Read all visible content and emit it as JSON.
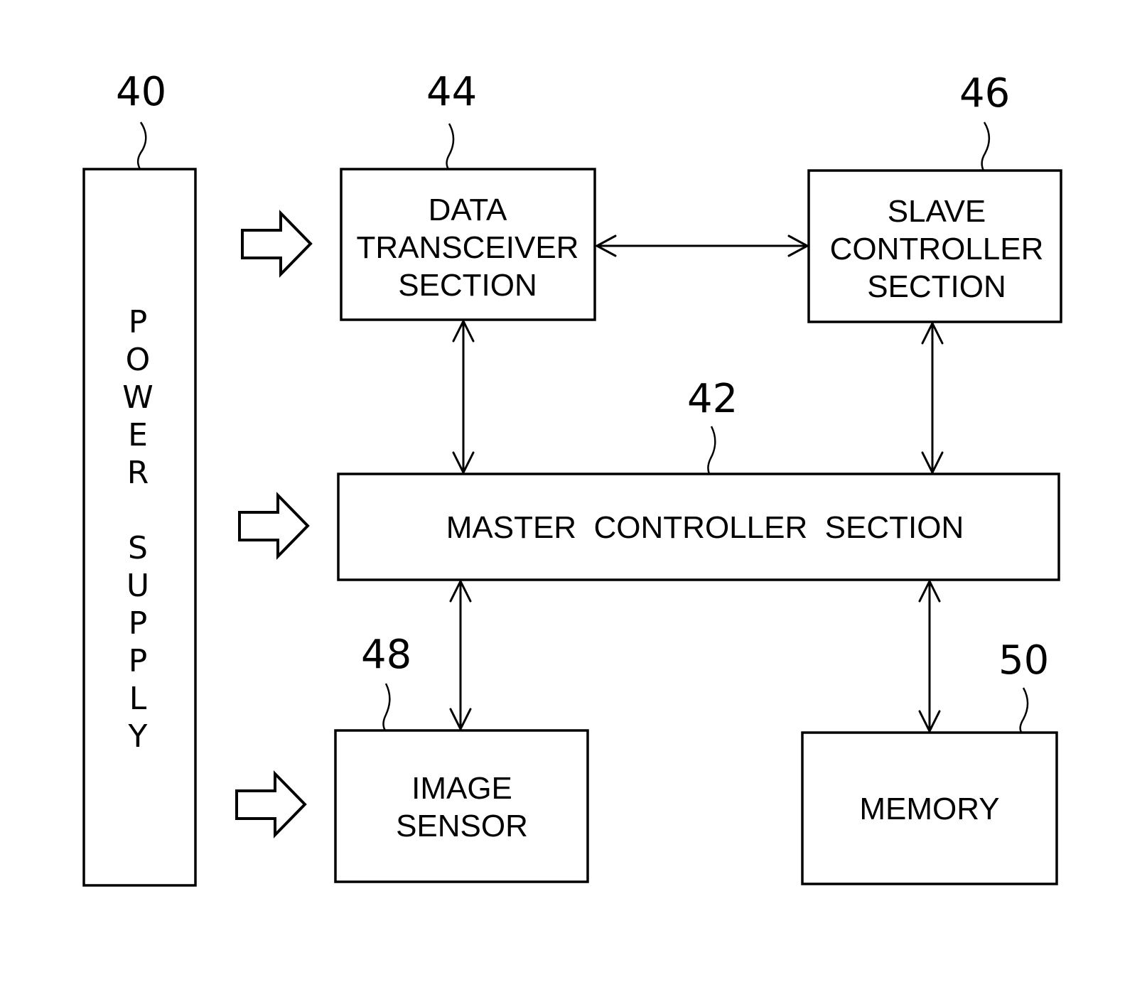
{
  "figure": {
    "blocks": [
      {
        "id": "power_supply",
        "ref": "40",
        "label_lines": [
          "POWER SUPPLY"
        ],
        "vertical": true
      },
      {
        "id": "master_controller",
        "ref": "42",
        "label_lines": [
          "MASTER  CONTROLLER  SECTION"
        ]
      },
      {
        "id": "data_transceiver",
        "ref": "44",
        "label_lines": [
          "DATA",
          "TRANSCEIVER",
          "SECTION"
        ]
      },
      {
        "id": "slave_controller",
        "ref": "46",
        "label_lines": [
          "SLAVE",
          "CONTROLLER",
          "SECTION"
        ]
      },
      {
        "id": "image_sensor",
        "ref": "48",
        "label_lines": [
          "IMAGE",
          "SENSOR"
        ]
      },
      {
        "id": "memory",
        "ref": "50",
        "label_lines": [
          "MEMORY"
        ]
      }
    ],
    "connections": [
      {
        "from": "data_transceiver",
        "to": "slave_controller",
        "type": "bidirectional"
      },
      {
        "from": "data_transceiver",
        "to": "master_controller",
        "type": "bidirectional"
      },
      {
        "from": "slave_controller",
        "to": "master_controller",
        "type": "bidirectional"
      },
      {
        "from": "master_controller",
        "to": "image_sensor",
        "type": "bidirectional"
      },
      {
        "from": "master_controller",
        "to": "memory",
        "type": "bidirectional"
      }
    ],
    "power_feeds": [
      {
        "from": "power_supply",
        "to": "data_transceiver",
        "type": "hollow-arrow"
      },
      {
        "from": "power_supply",
        "to": "master_controller",
        "type": "hollow-arrow"
      },
      {
        "from": "power_supply",
        "to": "image_sensor",
        "type": "hollow-arrow"
      }
    ],
    "power_label_chars": [
      "P",
      "O",
      "W",
      "E",
      "R",
      "",
      "S",
      "U",
      "P",
      "P",
      "L",
      "Y"
    ]
  }
}
